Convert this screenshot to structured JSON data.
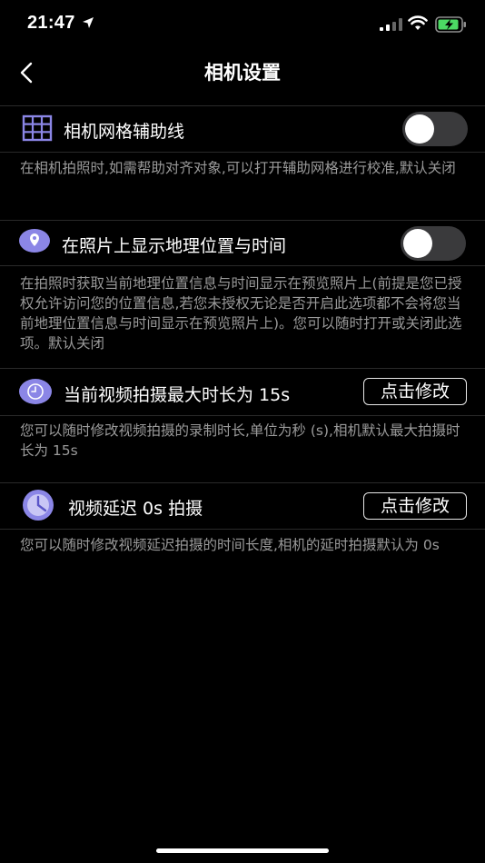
{
  "status": {
    "time": "21:47"
  },
  "nav": {
    "title": "相机设置"
  },
  "settings": [
    {
      "label": "相机网格辅助线",
      "control": "toggle",
      "enabled": false,
      "description": "在相机拍照时,如需帮助对齐对象,可以打开辅助网格进行校准,默认关闭"
    },
    {
      "label": "在照片上显示地理位置与时间",
      "control": "toggle",
      "enabled": false,
      "description": "在拍照时获取当前地理位置信息与时间显示在预览照片上(前提是您已授权允许访问您的位置信息,若您未授权无论是否开启此选项都不会将您当前地理位置信息与时间显示在预览照片上)。您可以随时打开或关闭此选项。默认关闭"
    },
    {
      "label": "当前视频拍摄最大时长为 15s",
      "control": "button",
      "button_label": "点击修改",
      "description": "您可以随时修改视频拍摄的录制时长,单位为秒 (s),相机默认最大拍摄时长为 15s"
    },
    {
      "label": "视频延迟 0s 拍摄",
      "control": "button",
      "button_label": "点击修改",
      "description": "您可以随时修改视频延迟拍摄的时间长度,相机的延时拍摄默认为 0s"
    }
  ],
  "colors": {
    "icon_purple": "#8b86e6",
    "toggle_off": "#3a3a3c"
  }
}
